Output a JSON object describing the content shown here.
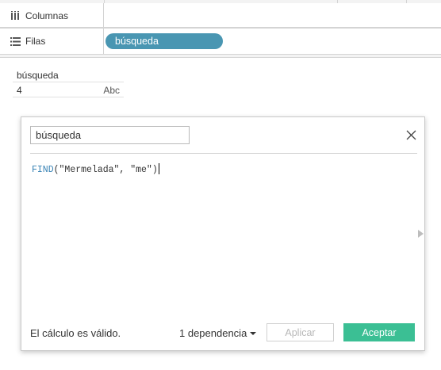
{
  "shelves": {
    "columns_label": "Columnas",
    "rows_label": "Filas",
    "rows_pill": "búsqueda"
  },
  "table": {
    "header": "búsqueda",
    "value": "4",
    "type_label": "Abc"
  },
  "dialog": {
    "name": "búsqueda",
    "formula": {
      "function": "FIND",
      "open": "(",
      "args": "\"Mermelada\", \"me\"",
      "close": ")"
    },
    "status": "El cálculo es válido.",
    "dependency": "1 dependencia",
    "apply_label": "Aplicar",
    "ok_label": "Aceptar"
  },
  "colors": {
    "pill": "#4996b2",
    "ok_button": "#3bbf94",
    "keyword": "#3a84b6"
  },
  "icons": {
    "columns": "columns-icon",
    "rows": "rows-icon",
    "close": "close-icon",
    "dropdown": "caret-down-icon",
    "expand": "triangle-right-icon"
  }
}
